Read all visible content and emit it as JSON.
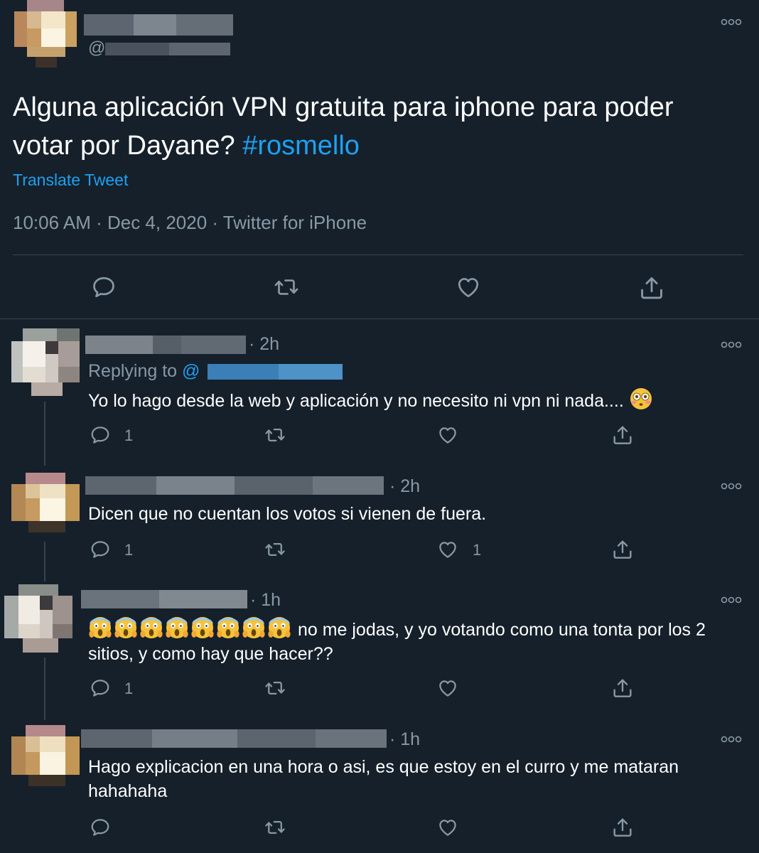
{
  "main_tweet": {
    "handle_prefix": "@",
    "text_main": "Alguna aplicación VPN gratuita para iphone para poder votar por Dayane? ",
    "hashtag": "#rosmello",
    "translate_label": "Translate Tweet",
    "timestamp": "10:06 AM · Dec 4, 2020 · Twitter for iPhone"
  },
  "replies": [
    {
      "time": "· 2h",
      "replying_label": "Replying to ",
      "replying_handle": "@",
      "text": "Yo lo hago desde la web y aplicación y no necesito ni vpn ni nada.... ",
      "reply_count": "1",
      "like_count": ""
    },
    {
      "time": "· 2h",
      "text": "Dicen que no cuentan los votos si vienen de fuera.",
      "reply_count": "1",
      "like_count": "1"
    },
    {
      "time": "· 1h",
      "text": " no me jodas, y yo votando como una tonta por los 2 sitios, y como hay que hacer??",
      "reply_count": "1",
      "like_count": ""
    },
    {
      "time": "· 1h",
      "text": "Hago explicacion en una hora o asi, es que estoy en el curro y me mataran hahahaha",
      "reply_count": "",
      "like_count": ""
    }
  ],
  "icons": [
    "reply-icon",
    "retweet-icon",
    "like-icon",
    "share-icon",
    "more-icon",
    "flushed-face-emoji",
    "screaming-face-emoji"
  ],
  "colors": {
    "background": "#15202b",
    "text": "#ffffff",
    "muted": "#8899a6",
    "accent": "#1da1f2",
    "divider": "#38444d"
  }
}
